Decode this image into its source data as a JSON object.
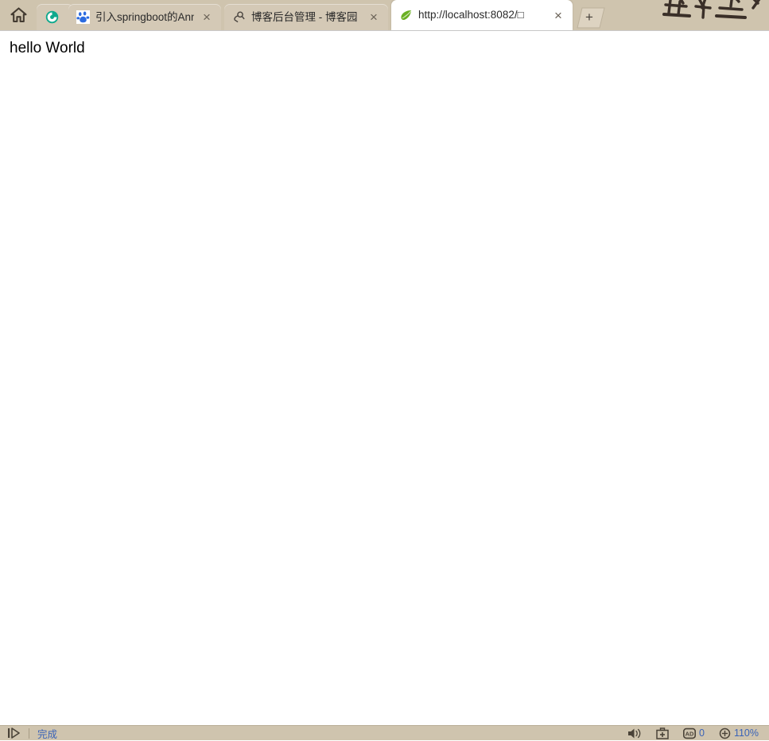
{
  "window": {
    "chrome_bg": "#cfc4ae",
    "active_tab_bg": "#ffffff",
    "status_link_color": "#3a63b8"
  },
  "toolbar": {
    "home_label": "主页",
    "home_icon": "home-icon"
  },
  "tabs": [
    {
      "id": "browser-logo",
      "title": "",
      "favicon": "browser-logo-icon",
      "active": false,
      "closable": false
    },
    {
      "id": "tab-baidu-springboot",
      "title": "引入springboot的Anno",
      "favicon": "baidu-paw-icon",
      "active": false,
      "closable": true,
      "close_label": "×"
    },
    {
      "id": "tab-cnblogs-admin",
      "title": "博客后台管理 - 博客园",
      "favicon": "cnblogs-icon",
      "active": false,
      "closable": true,
      "close_label": "×"
    },
    {
      "id": "tab-localhost-8082",
      "title": "http://localhost:8082/□",
      "favicon": "spring-leaf-icon",
      "active": true,
      "closable": true,
      "close_label": "×"
    }
  ],
  "newtab": {
    "label": "+",
    "name": "new-tab-button"
  },
  "page": {
    "body_text": "hello World"
  },
  "statusbar": {
    "playback_icon": "play-pause-icon",
    "status_text": "完成",
    "items": [
      {
        "id": "mute-toggle",
        "icon": "speaker-icon",
        "label": ""
      },
      {
        "id": "toolbox",
        "icon": "toolbox-icon",
        "label": ""
      },
      {
        "id": "ad-blocker",
        "icon": "ad-block-icon",
        "label": "0"
      },
      {
        "id": "zoom-level",
        "icon": "zoom-in-icon",
        "label": "110%"
      }
    ]
  }
}
